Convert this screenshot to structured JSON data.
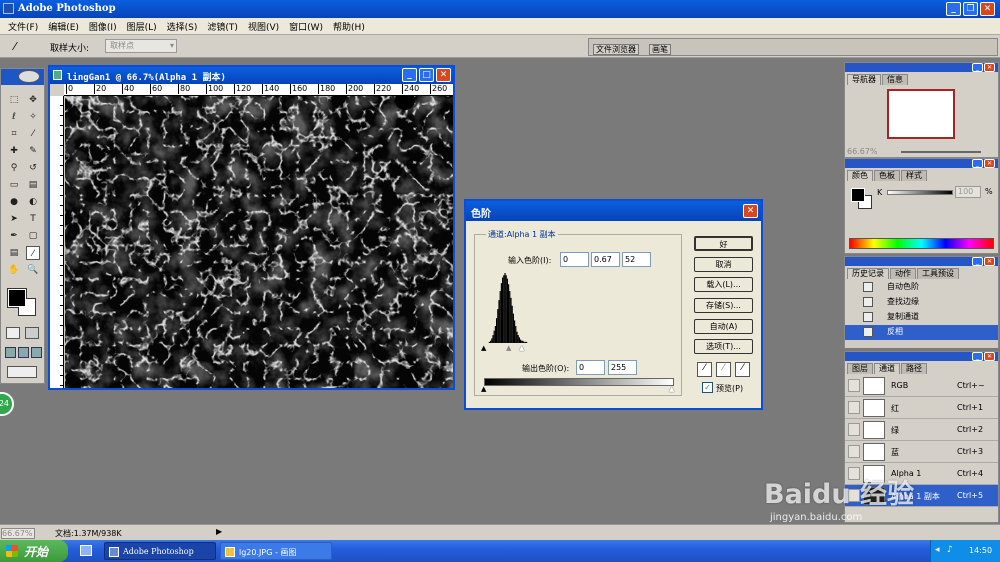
{
  "app": {
    "title": "Adobe Photoshop"
  },
  "menu": [
    "文件(F)",
    "编辑(E)",
    "图像(I)",
    "图层(L)",
    "选择(S)",
    "滤镜(T)",
    "视图(V)",
    "窗口(W)",
    "帮助(H)"
  ],
  "options": {
    "sample_size_label": "取样大小:",
    "sample_size_value": "取样点"
  },
  "dock_tabs": [
    "文件浏览器",
    "画笔"
  ],
  "document": {
    "title": "lingGan1 @ 66.7%(Alpha 1 副本)",
    "ruler_ticks": [
      "0",
      "20",
      "40",
      "60",
      "80",
      "100",
      "120",
      "140",
      "160",
      "180",
      "200",
      "220",
      "240",
      "260"
    ]
  },
  "levels": {
    "title": "色阶",
    "channel_label": "通道:Alpha 1 副本",
    "input_label": "输入色阶(I):",
    "input_values": [
      "0",
      "0.67",
      "52"
    ],
    "output_label": "输出色阶(O):",
    "output_values": [
      "0",
      "255"
    ],
    "buttons": {
      "ok": "好",
      "cancel": "取消",
      "load": "载入(L)...",
      "save": "存储(S)...",
      "auto": "自动(A)",
      "options": "选项(T)..."
    },
    "preview_label": "预览(P)",
    "histogram": [
      0,
      0,
      0,
      0,
      1,
      2,
      4,
      7,
      11,
      15,
      22,
      30,
      38,
      46,
      53,
      58,
      60,
      62,
      60,
      57,
      52,
      46,
      40,
      33,
      26,
      20,
      15,
      10,
      7,
      5,
      3,
      2,
      2,
      1,
      1,
      1,
      0,
      0,
      0,
      0,
      0,
      0
    ]
  },
  "navigator": {
    "tabs": [
      "导航器",
      "信息"
    ],
    "zoom": "66.67%"
  },
  "color_panel": {
    "tabs": [
      "颜色",
      "色板",
      "样式"
    ],
    "k_label": "K",
    "k_value": "100",
    "percent": "%"
  },
  "history": {
    "tabs": [
      "历史记录",
      "动作",
      "工具预设"
    ],
    "items": [
      "自动色阶",
      "查找边缘",
      "复制通道",
      "反相"
    ]
  },
  "channels": {
    "tabs": [
      "图层",
      "通道",
      "路径"
    ],
    "rows": [
      {
        "name": "RGB",
        "shortcut": "Ctrl+~"
      },
      {
        "name": "红",
        "shortcut": "Ctrl+1"
      },
      {
        "name": "绿",
        "shortcut": "Ctrl+2"
      },
      {
        "name": "蓝",
        "shortcut": "Ctrl+3"
      },
      {
        "name": "Alpha 1",
        "shortcut": "Ctrl+4"
      },
      {
        "name": "Alpha 1 副本",
        "shortcut": "Ctrl+5"
      }
    ]
  },
  "status": {
    "zoom": "66.67%",
    "doc": "文档:1.37M/938K"
  },
  "taskbar": {
    "start": "开始",
    "items": [
      "Adobe Photoshop",
      "lg20.JPG - 画图"
    ],
    "clock": "14:50"
  },
  "badge": "24",
  "watermark": {
    "brand": "Baidu 经验",
    "url": "jingyan.baidu.com"
  },
  "colors": {
    "titlebar": "#0a5fe0",
    "taskbar": "#245edb",
    "start": "#3c9a3c",
    "workspace": "#7a7a7a",
    "panel": "#d4d0c8"
  }
}
